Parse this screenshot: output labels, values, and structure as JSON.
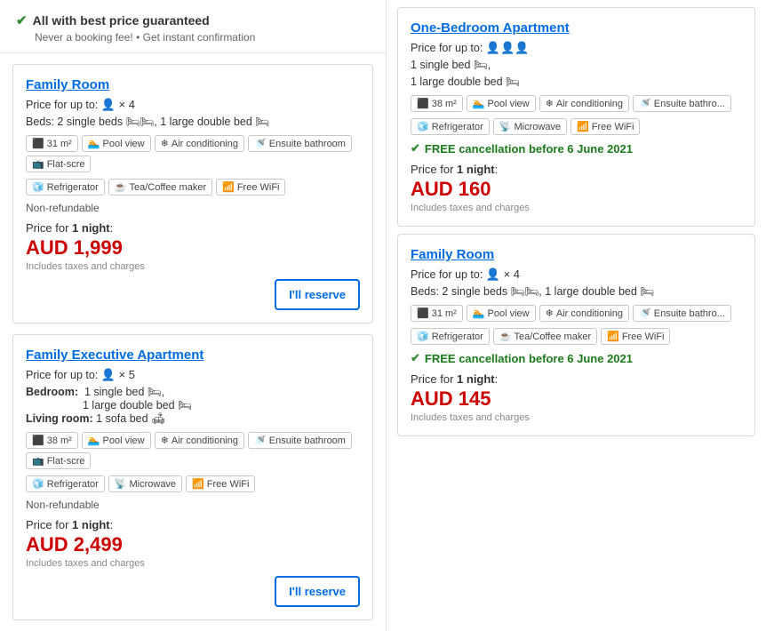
{
  "banner": {
    "title": "All with best price guaranteed",
    "subtitle": "Never a booking fee! • Get instant confirmation",
    "check_icon": "✔"
  },
  "left": {
    "cards": [
      {
        "id": "family-room-left",
        "title": "Family Room",
        "price_for_label": "Price for up to:",
        "person_icons": "👤 × 4",
        "beds_label": "Beds: 2 single beds 🛏🛏, 1 large double bed 🛏",
        "amenities": [
          {
            "icon": "⬛",
            "label": "31 m²"
          },
          {
            "icon": "🏊",
            "label": "Pool view"
          },
          {
            "icon": "❄",
            "label": "Air conditioning"
          },
          {
            "icon": "🚿",
            "label": "Ensuite bathroom"
          },
          {
            "icon": "📺",
            "label": "Flat-scre..."
          }
        ],
        "amenities2": [
          {
            "icon": "🧊",
            "label": "Refrigerator"
          },
          {
            "icon": "☕",
            "label": "Tea/Coffee maker"
          },
          {
            "icon": "📶",
            "label": "Free WiFi"
          }
        ],
        "policy": "Non-refundable",
        "price_for_night": "Price for",
        "night_bold": "1 night",
        "price": "AUD 1,999",
        "includes": "Includes taxes and charges"
      },
      {
        "id": "family-executive-left",
        "title": "Family Executive Apartment",
        "price_for_label": "Price for up to:",
        "person_icons": "👤 × 5",
        "bedroom_label": "Bedroom:",
        "bedroom_bed1": "1 single bed 🛏,",
        "bedroom_bed2": "1 large double bed 🛏",
        "living_label": "Living room:",
        "living_bed": "1 sofa bed 🛋",
        "amenities": [
          {
            "icon": "⬛",
            "label": "38 m²"
          },
          {
            "icon": "🏊",
            "label": "Pool view"
          },
          {
            "icon": "❄",
            "label": "Air conditioning"
          },
          {
            "icon": "🚿",
            "label": "Ensuite bathroom"
          },
          {
            "icon": "📺",
            "label": "Flat-scre..."
          }
        ],
        "amenities2": [
          {
            "icon": "🧊",
            "label": "Refrigerator"
          },
          {
            "icon": "📡",
            "label": "Microwave"
          },
          {
            "icon": "📶",
            "label": "Free WiFi"
          }
        ],
        "policy": "Non-refundable",
        "price_for_night": "Price for",
        "night_bold": "1 night",
        "price": "AUD 2,499",
        "includes": "Includes taxes and charges"
      }
    ]
  },
  "right": {
    "cards": [
      {
        "id": "one-bedroom-right",
        "title": "One-Bedroom Apartment",
        "price_for_label": "Price for up to:",
        "person_icons": "👤👤👤",
        "bed1": "1 single bed 🛏,",
        "bed2": "1 large double bed 🛏",
        "amenities": [
          {
            "icon": "⬛",
            "label": "38 m²"
          },
          {
            "icon": "🏊",
            "label": "Pool view"
          },
          {
            "icon": "❄",
            "label": "Air conditioning"
          },
          {
            "icon": "🚿",
            "label": "Ensuite bathro..."
          }
        ],
        "amenities2": [
          {
            "icon": "🧊",
            "label": "Refrigerator"
          },
          {
            "icon": "📡",
            "label": "Microwave"
          },
          {
            "icon": "📶",
            "label": "Free WiFi"
          }
        ],
        "free_cancel": "FREE cancellation before 6 June 2021",
        "price_for_night": "Price for",
        "night_bold": "1 night",
        "price": "AUD 160",
        "includes": "Includes taxes and charges"
      },
      {
        "id": "family-room-right",
        "title": "Family Room",
        "price_for_label": "Price for up to:",
        "person_icons": "👤 × 4",
        "beds_label": "Beds: 2 single beds 🛏🛏, 1 large double bed 🛏",
        "amenities": [
          {
            "icon": "⬛",
            "label": "31 m²"
          },
          {
            "icon": "🏊",
            "label": "Pool view"
          },
          {
            "icon": "❄",
            "label": "Air conditioning"
          },
          {
            "icon": "🚿",
            "label": "Ensuite bathro..."
          }
        ],
        "amenities2": [
          {
            "icon": "🧊",
            "label": "Refrigerator"
          },
          {
            "icon": "☕",
            "label": "Tea/Coffee maker"
          },
          {
            "icon": "📶",
            "label": "Free WiFi"
          }
        ],
        "free_cancel": "FREE cancellation before 6 June 2021",
        "price_for_night": "Price for",
        "night_bold": "1 night",
        "price": "AUD 145",
        "includes": "Includes taxes and charges"
      }
    ]
  }
}
